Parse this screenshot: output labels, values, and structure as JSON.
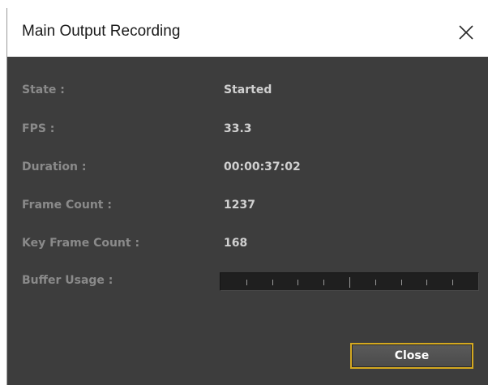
{
  "dialog": {
    "title": "Main Output Recording",
    "close_icon": "close-icon"
  },
  "fields": [
    {
      "label": "State :",
      "value": "Started"
    },
    {
      "label": "FPS :",
      "value": "33.3"
    },
    {
      "label": "Duration :",
      "value": "00:00:37:02"
    },
    {
      "label": "Frame Count :",
      "value": "1237"
    },
    {
      "label": "Key Frame Count :",
      "value": "168"
    }
  ],
  "buffer": {
    "label": "Buffer Usage :",
    "usage_fraction": 0
  },
  "buttons": {
    "close_label": "Close"
  },
  "colors": {
    "panel_background": "#3d3d3d",
    "focus_border": "#d4a820"
  }
}
